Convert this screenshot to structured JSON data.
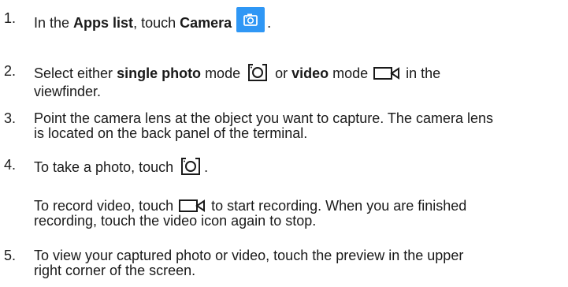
{
  "steps": [
    {
      "number": "1.",
      "pre": "In the ",
      "b1": "Apps list",
      "mid": ", touch ",
      "b2": "Camera",
      "icon": "camera-app-icon",
      "end": "."
    },
    {
      "number": "2.",
      "pre": "Select either ",
      "b1": "single photo",
      "mid1": " mode ",
      "icon1": "photo-mode-icon",
      "mid2": " or ",
      "b2": "video",
      "mid3": " mode ",
      "icon2": "video-mode-icon",
      "end1": " in the",
      "line2": "viewfinder."
    },
    {
      "number": "3.",
      "line1": "Point the camera lens at the object you want to capture. The camera lens",
      "line2": "is located on the back panel of the terminal."
    },
    {
      "number": "4.",
      "pre": "To take a photo, touch ",
      "icon": "photo-mode-icon",
      "end": "."
    },
    {
      "pre": "To record video, touch ",
      "icon": "video-mode-icon",
      "line1_end": " to start recording. When you are finished",
      "line2": "recording, touch the video icon again to stop."
    },
    {
      "number": "5.",
      "line1": "To view your captured photo or video, touch the preview in the upper",
      "line2": "right corner of the screen."
    }
  ],
  "colors": {
    "text": "#1a1a1a",
    "camera_app_bg": "#2f97f5"
  }
}
